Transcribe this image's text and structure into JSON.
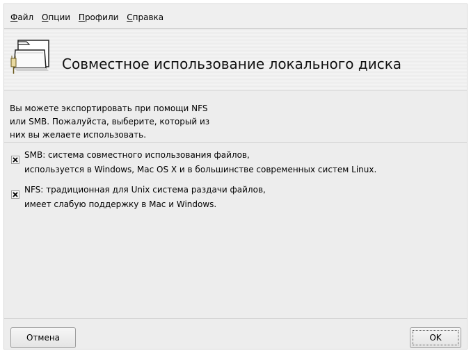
{
  "menubar": {
    "items": [
      {
        "mnemonic": "Ф",
        "rest": "айл"
      },
      {
        "mnemonic": "О",
        "rest": "пции"
      },
      {
        "mnemonic": "П",
        "rest": "рофили"
      },
      {
        "mnemonic": "С",
        "rest": "правка"
      }
    ]
  },
  "header": {
    "title": "Совместное использование локального диска",
    "icon": "folder-share-icon"
  },
  "intro_text": "Вы можете экспортировать при помощи NFS\nили SMB. Пожалуйста, выберите, который из\nних вы желаете использовать.",
  "options": [
    {
      "label": "SMB: система совместного использования файлов,\nиспользуется в Windows, Mac OS X и в большинстве современных систем Linux.",
      "checked": true
    },
    {
      "label": "NFS: традиционная для Unix система раздачи файлов,\nимеет слабую поддержку в Mac и Windows.",
      "checked": true
    }
  ],
  "buttons": {
    "cancel": "Отмена",
    "ok": "OK"
  }
}
